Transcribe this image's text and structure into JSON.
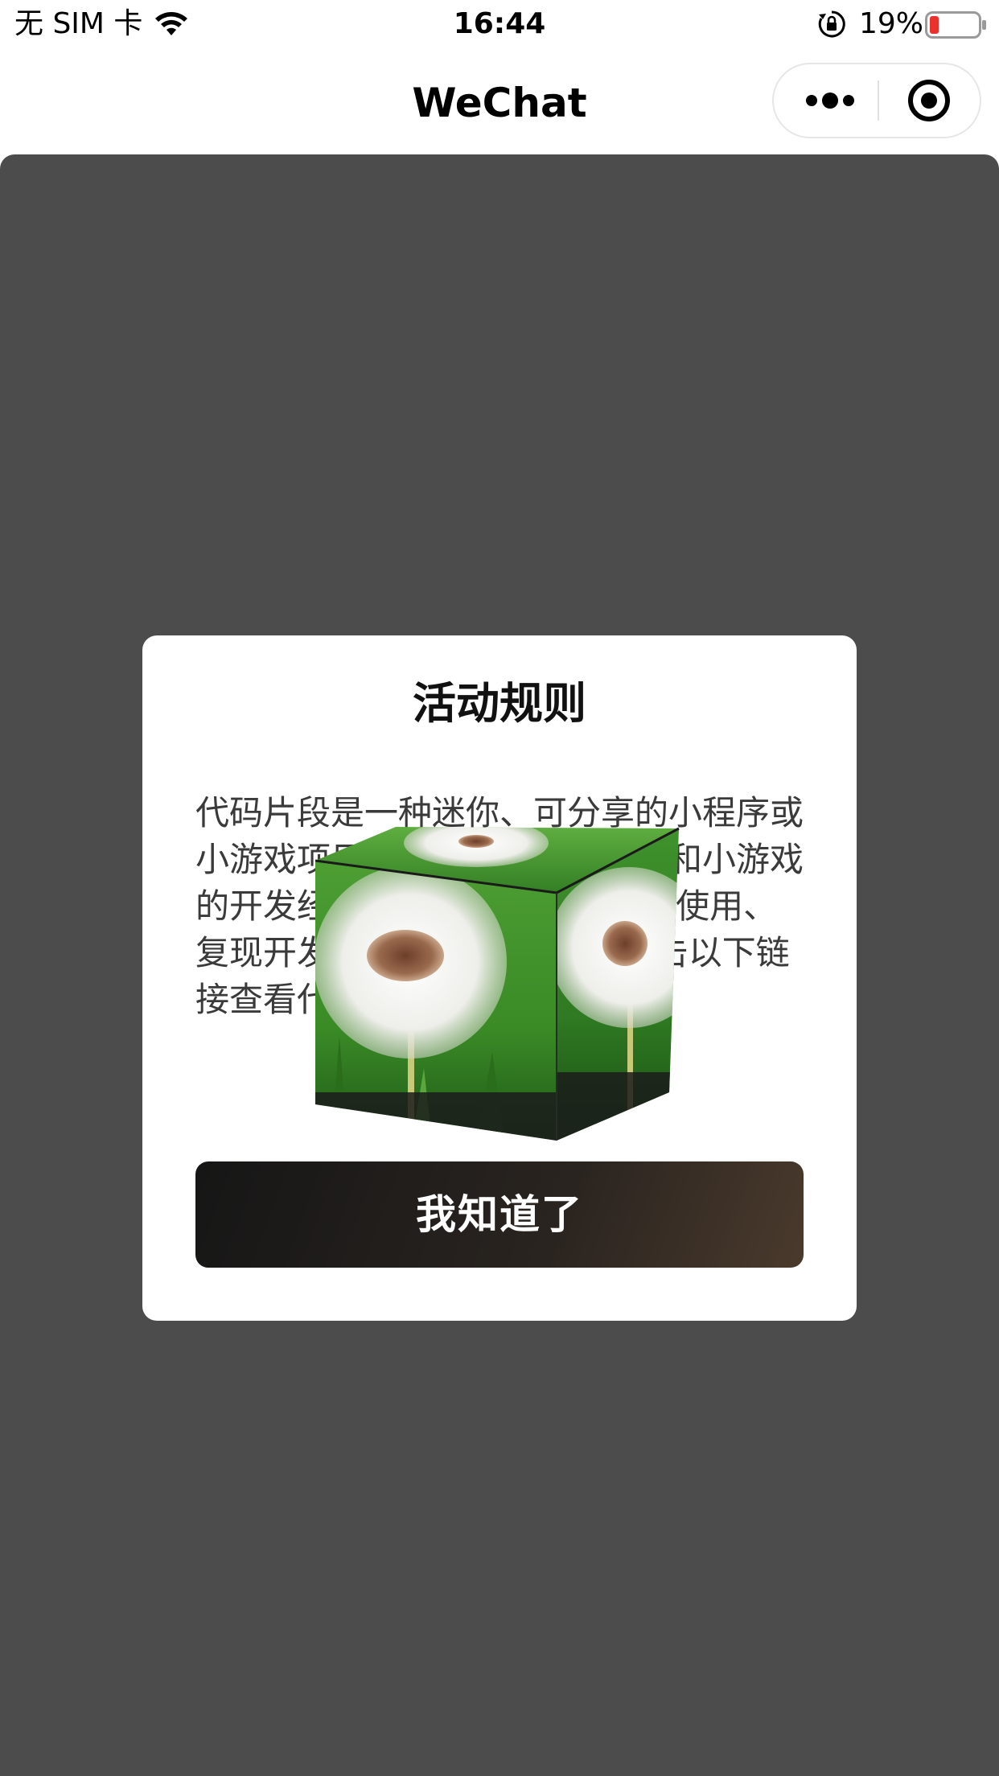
{
  "status_bar": {
    "carrier": "无 SIM 卡",
    "time": "16:44",
    "battery_percent": "19%",
    "icons": [
      "wifi-icon",
      "orientation-lock-icon",
      "battery-icon"
    ],
    "battery_color": "#e8322b"
  },
  "nav": {
    "title": "WeChat",
    "more_icon": "more-dots-icon",
    "close_icon": "target-close-icon"
  },
  "overlay": {
    "background_color": "#4c4c4c"
  },
  "modal": {
    "title": "活动规则",
    "body": "代码片段是一种迷你、可分享的小程序或小游戏项目，可用于分享小程序和小游戏的开发经验、展示组件和 API 的使用、复现开发问题和 Bug 等。可点击以下链接查看代码片段的详细文档",
    "button_label": "我知道了"
  },
  "image": {
    "semantic": "dandelion-cube-image",
    "colors": {
      "grass": "#3f8f2a",
      "grass_dark": "#1e5a17",
      "seed_white": "#f2f2ee",
      "seed_center": "#8a5a3c"
    }
  }
}
